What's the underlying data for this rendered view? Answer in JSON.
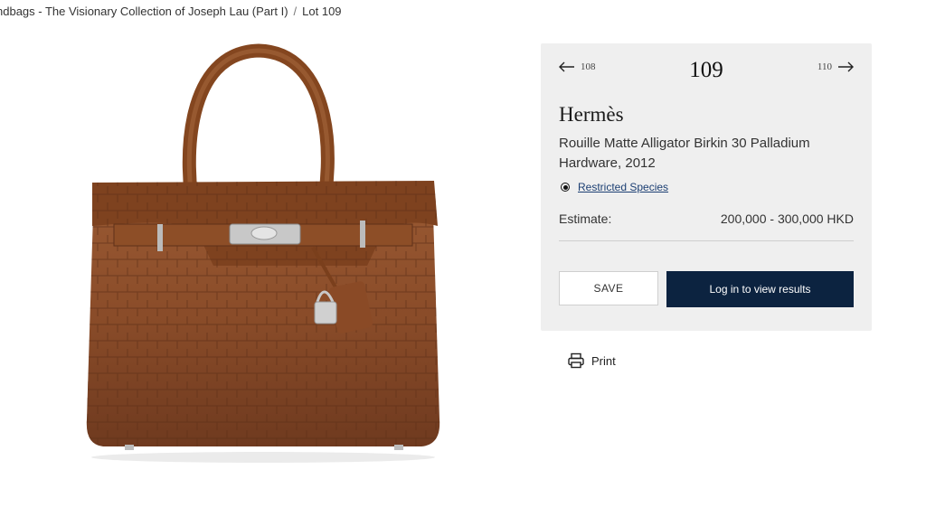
{
  "breadcrumb": {
    "section": "ndbags - The Visionary Collection of Joseph Lau (Part I)",
    "separator": "/",
    "current": "Lot 109"
  },
  "image": {
    "alt": "Hermès Rouille Matte Alligator Birkin 30 handbag"
  },
  "lot_nav": {
    "prev_lot": "108",
    "current_lot": "109",
    "next_lot": "110"
  },
  "lot": {
    "maker": "Hermès",
    "title": "Rouille Matte Alligator Birkin 30 Palladium Hardware, 2012",
    "restricted_label": "Restricted Species",
    "estimate_label": "Estimate:",
    "estimate_value": "200,000 - 300,000 HKD"
  },
  "actions": {
    "save_label": "SAVE",
    "login_label": "Log in to view results",
    "print_label": "Print"
  },
  "colors": {
    "panel_bg": "#efefef",
    "primary_button": "#0c2340",
    "link": "#1c3f73"
  }
}
